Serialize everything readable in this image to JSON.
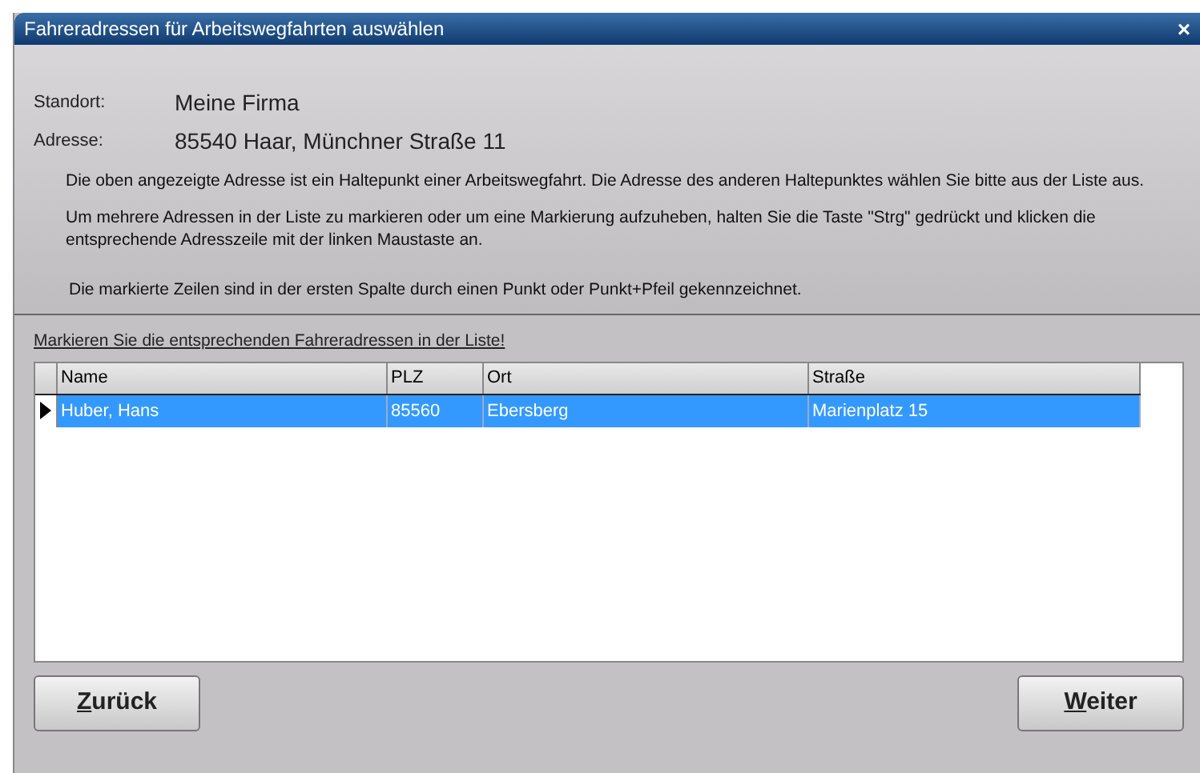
{
  "window": {
    "title": "Fahreradressen für Arbeitswegfahrten auswählen",
    "close": "×"
  },
  "info": {
    "fields": [
      {
        "label": "Standort:",
        "value": "Meine Firma"
      },
      {
        "label": "Adresse:",
        "value": "85540 Haar, Münchner Straße 11"
      }
    ],
    "paragraphs": [
      "Die oben angezeigte Adresse ist ein Haltepunkt einer Arbeitswegfahrt. Die Adresse des anderen Haltepunktes wählen Sie bitte aus der Liste aus.",
      "Um mehrere Adressen in der Liste zu markieren oder um eine Markierung aufzuheben, halten Sie die Taste \"Strg\" gedrückt und klicken die entsprechende Adresszeile mit der linken Maustaste an.",
      "Die markierte Zeilen sind in der ersten Spalte durch einen Punkt oder Punkt+Pfeil gekennzeichnet."
    ]
  },
  "list_hint": "Markieren Sie die entsprechenden Fahreradressen in der Liste!",
  "table": {
    "columns": [
      "Name",
      "PLZ",
      "Ort",
      "Straße"
    ],
    "rows": [
      {
        "cells": [
          "Huber, Hans",
          "85560",
          "Ebersberg",
          "Marienplatz 15"
        ],
        "selected": true,
        "current": true
      }
    ]
  },
  "buttons": [
    "Zurück",
    "Weiter"
  ]
}
